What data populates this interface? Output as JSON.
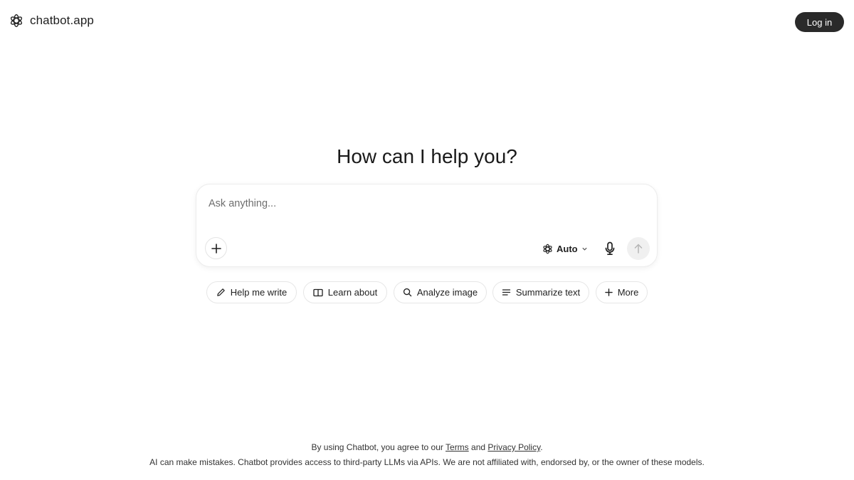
{
  "header": {
    "brand_name": "chatbot.app",
    "login_label": "Log in"
  },
  "hero": {
    "title": "How can I help you?"
  },
  "composer": {
    "placeholder": "Ask anything...",
    "model_label": "Auto",
    "icons": {
      "attach": "plus-icon",
      "model": "chatbot-logo-icon",
      "model_dropdown": "chevron-down-icon",
      "mic": "microphone-icon",
      "send": "arrow-up-icon"
    }
  },
  "suggestions": [
    {
      "label": "Help me write",
      "icon": "pencil-icon"
    },
    {
      "label": "Learn about",
      "icon": "book-icon"
    },
    {
      "label": "Analyze image",
      "icon": "search-icon"
    },
    {
      "label": "Summarize text",
      "icon": "lines-icon"
    },
    {
      "label": "More",
      "icon": "plus-icon"
    }
  ],
  "footer": {
    "agree_prefix": "By using Chatbot, you agree to our",
    "terms_label": "Terms",
    "and": "and",
    "privacy_label": "Privacy Policy",
    "period": ".",
    "disclaimer": "AI can make mistakes. Chatbot provides access to third-party LLMs via APIs. We are not affiliated with, endorsed by, or the owner of these models."
  },
  "colors": {
    "login_bg": "#2a2a2a",
    "send_bg": "#f0f0f0",
    "border": "#e6e6e6"
  }
}
